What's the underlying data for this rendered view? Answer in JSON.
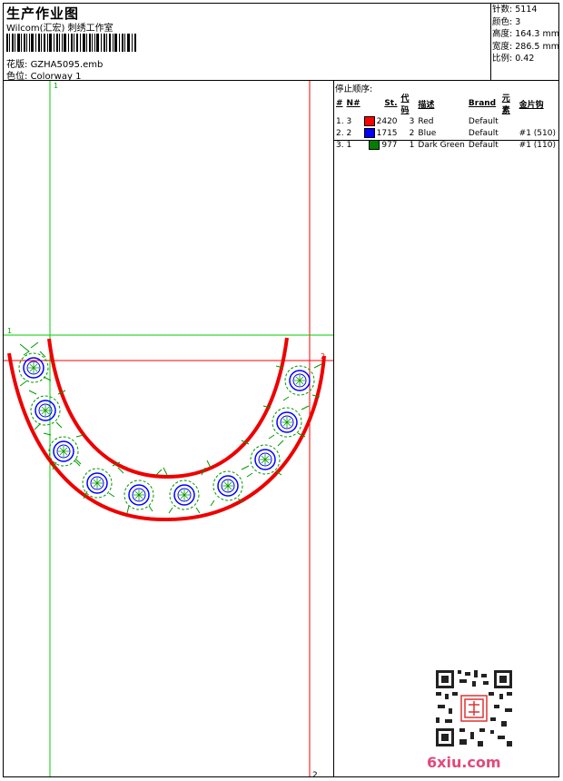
{
  "header": {
    "title": "生产作业图",
    "studio": "Wilcom(汇宏) 刺绣工作室",
    "design_label": "花版:",
    "design_value": "GZHA5095.emb",
    "colorway_label": "色位:",
    "colorway_value": "Colorway 1"
  },
  "stats": {
    "stitches_label": "针数:",
    "stitches_value": "5114",
    "colors_label": "颜色:",
    "colors_value": "3",
    "height_label": "高度:",
    "height_value": "164.3 mm",
    "width_label": "宽度:",
    "width_value": "286.5 mm",
    "scale_label": "比例:",
    "scale_value": "0.42"
  },
  "stop_sequence": {
    "title": "停止顺序:",
    "columns": [
      "#",
      "N#",
      "St.",
      "代码",
      "描述",
      "Brand",
      "元素",
      "金片钩"
    ],
    "rows": [
      {
        "no": "1. 3",
        "color": "#ff0000",
        "stitches": "2420",
        "code": "3",
        "desc": "Red",
        "brand": "Default",
        "element": "",
        "sequin": ""
      },
      {
        "no": "2. 2",
        "color": "#0000ff",
        "stitches": "1715",
        "code": "2",
        "desc": "Blue",
        "brand": "Default",
        "element": "",
        "sequin": "#1 (510)"
      },
      {
        "no": "3. 1",
        "color": "#008000",
        "stitches": "977",
        "code": "1",
        "desc": "Dark Green",
        "brand": "Default",
        "element": "",
        "sequin": "#1 (110)"
      }
    ]
  },
  "guides": {
    "h_num": "1",
    "v_num": "2",
    "top_num": "1",
    "right_num": "2"
  },
  "colors": {
    "guide_green": "#00cc00",
    "guide_red": "#ff0000",
    "thread_red": "#ee0000",
    "thread_blue": "#0000ff",
    "thread_green": "#009900"
  },
  "watermark": {
    "site": "6xiu.com",
    "icon": "qr-code-icon"
  }
}
